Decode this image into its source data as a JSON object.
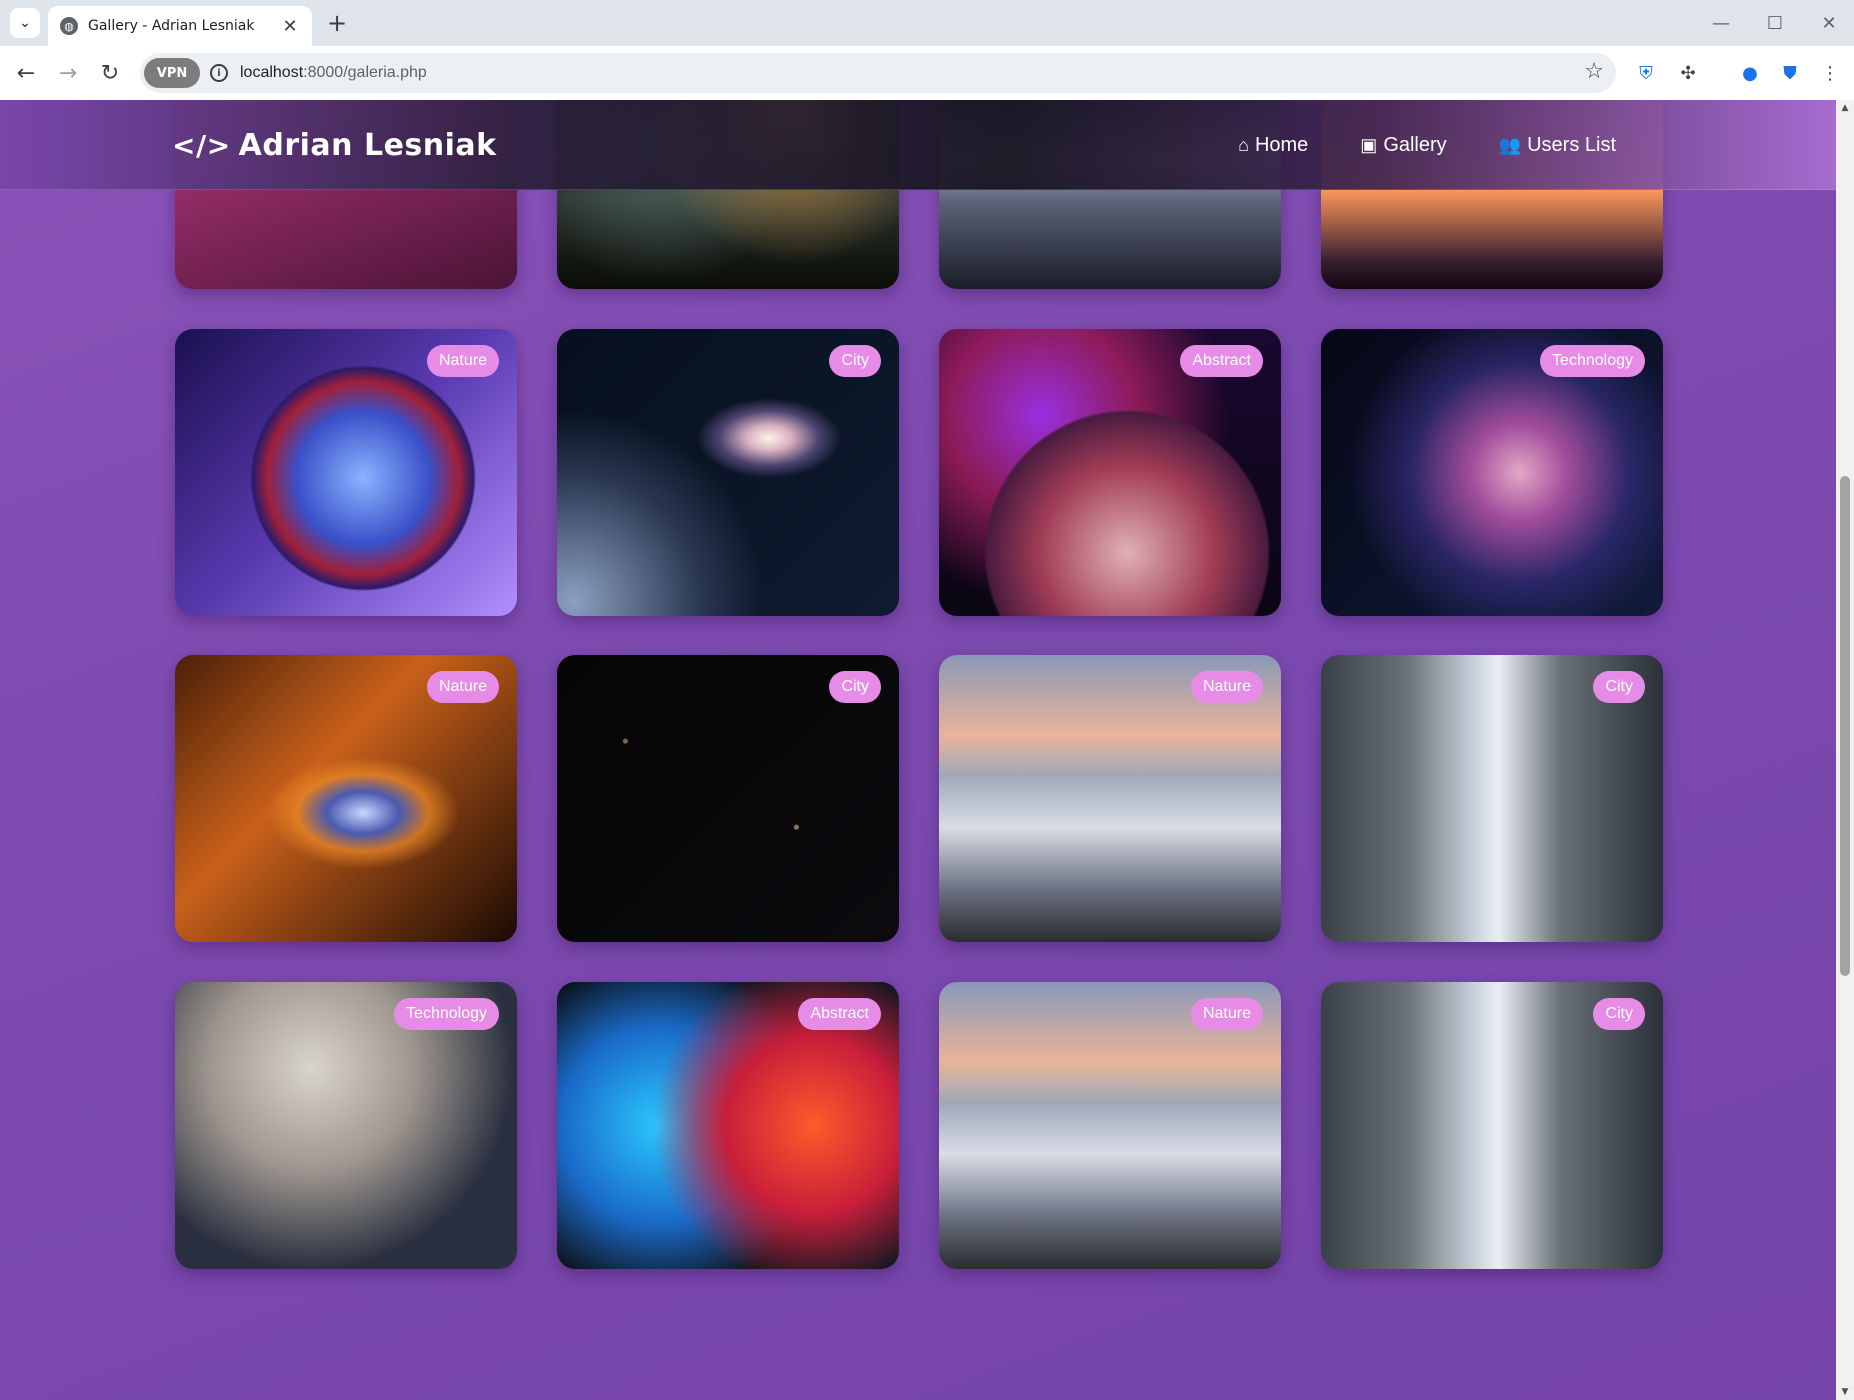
{
  "browser": {
    "tab_title": "Gallery - Adrian Lesniak",
    "url_host": "localhost",
    "url_rest": ":8000/galeria.php",
    "vpn_label": "VPN"
  },
  "site": {
    "logo_text": "Adrian Lesniak",
    "nav": [
      {
        "label": "Home",
        "icon": "home-icon"
      },
      {
        "label": "Gallery",
        "icon": "gallery-icon"
      },
      {
        "label": "Users List",
        "icon": "users-icon"
      }
    ]
  },
  "gallery": {
    "rows": [
      [
        {
          "image": "pink-galaxy",
          "badge": ""
        },
        {
          "image": "tree-under-night-sky",
          "badge": ""
        },
        {
          "image": "rocky-shore-night",
          "badge": ""
        },
        {
          "image": "joshua-tree-sunset",
          "badge": ""
        }
      ],
      [
        {
          "image": "blue-planet",
          "badge": "Nature"
        },
        {
          "image": "spiral-galaxy",
          "badge": "City"
        },
        {
          "image": "red-planet-moon",
          "badge": "Abstract"
        },
        {
          "image": "star-nebula",
          "badge": "Technology"
        }
      ],
      [
        {
          "image": "fire-nebula",
          "badge": "Nature"
        },
        {
          "image": "deep-field",
          "badge": "City"
        },
        {
          "image": "mountains-above-clouds",
          "badge": "Nature"
        },
        {
          "image": "city-street",
          "badge": "City"
        }
      ],
      [
        {
          "image": "worker-with-tools",
          "badge": "Technology"
        },
        {
          "image": "colorful-ink",
          "badge": "Abstract"
        },
        {
          "image": "mountains-above-clouds",
          "badge": "Nature"
        },
        {
          "image": "city-street",
          "badge": "City"
        }
      ]
    ]
  }
}
